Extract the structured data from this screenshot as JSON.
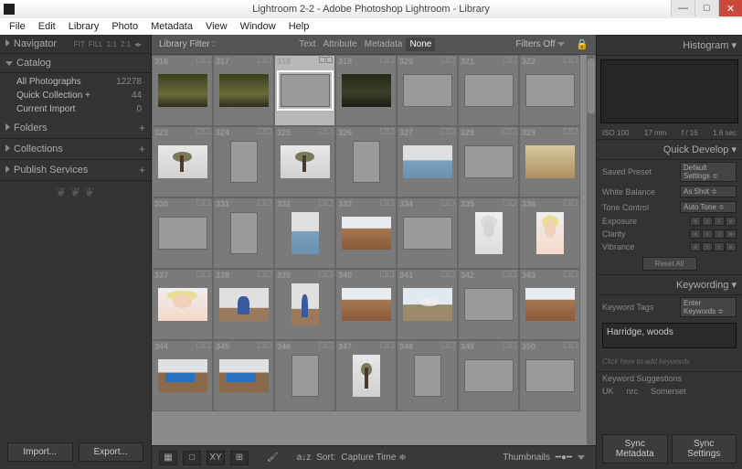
{
  "titlebar": {
    "title": "Lightroom 2-2 - Adobe Photoshop Lightroom - Library"
  },
  "menubar": [
    "File",
    "Edit",
    "Library",
    "Photo",
    "Metadata",
    "View",
    "Window",
    "Help"
  ],
  "left": {
    "navigator": {
      "label": "Navigator",
      "opts": [
        "FIT",
        "FILL",
        "1:1",
        "2:1"
      ]
    },
    "catalog": {
      "label": "Catalog",
      "items": [
        {
          "label": "All Photographs",
          "count": "12278"
        },
        {
          "label": "Quick Collection +",
          "count": "44"
        },
        {
          "label": "Current Import",
          "count": "0"
        }
      ]
    },
    "folders": {
      "label": "Folders"
    },
    "collections": {
      "label": "Collections"
    },
    "publish": {
      "label": "Publish Services"
    },
    "import_btn": "Import...",
    "export_btn": "Export..."
  },
  "filterbar": {
    "label": "Library Filter :",
    "tabs": [
      "Text",
      "Attribute",
      "Metadata",
      "None"
    ],
    "selected": "None",
    "filters_off": "Filters Off"
  },
  "grid": {
    "start_index": 316,
    "rows": [
      [
        {
          "n": "316",
          "kind": "river",
          "orient": "l"
        },
        {
          "n": "317",
          "kind": "river",
          "orient": "l"
        },
        {
          "n": "318",
          "kind": "blank",
          "orient": "l",
          "selected": true
        },
        {
          "n": "319",
          "kind": "river2",
          "orient": "l"
        },
        {
          "n": "320",
          "kind": "blank",
          "orient": "l"
        },
        {
          "n": "321",
          "kind": "blank",
          "orient": "l"
        },
        {
          "n": "322",
          "kind": "blank",
          "orient": "l"
        }
      ],
      [
        {
          "n": "323",
          "kind": "tree",
          "orient": "l"
        },
        {
          "n": "324",
          "kind": "blank",
          "orient": "p"
        },
        {
          "n": "325",
          "kind": "tree",
          "orient": "l"
        },
        {
          "n": "326",
          "kind": "blank",
          "orient": "p"
        },
        {
          "n": "327",
          "kind": "lake",
          "orient": "l"
        },
        {
          "n": "328",
          "kind": "blank",
          "orient": "l"
        },
        {
          "n": "329",
          "kind": "field",
          "orient": "l"
        }
      ],
      [
        {
          "n": "330",
          "kind": "blank",
          "orient": "l"
        },
        {
          "n": "331",
          "kind": "blank",
          "orient": "p"
        },
        {
          "n": "332",
          "kind": "lake",
          "orient": "p"
        },
        {
          "n": "333",
          "kind": "dirt",
          "orient": "l"
        },
        {
          "n": "334",
          "kind": "blank",
          "orient": "l"
        },
        {
          "n": "335",
          "kind": "portrait-bw",
          "orient": "p"
        },
        {
          "n": "336",
          "kind": "portrait",
          "orient": "p"
        }
      ],
      [
        {
          "n": "337",
          "kind": "portrait",
          "orient": "l"
        },
        {
          "n": "338",
          "kind": "walk",
          "orient": "l"
        },
        {
          "n": "339",
          "kind": "walk",
          "orient": "p"
        },
        {
          "n": "340",
          "kind": "dirt",
          "orient": "l"
        },
        {
          "n": "341",
          "kind": "smoke",
          "orient": "l"
        },
        {
          "n": "342",
          "kind": "blank",
          "orient": "l"
        },
        {
          "n": "343",
          "kind": "dirt",
          "orient": "l"
        }
      ],
      [
        {
          "n": "344",
          "kind": "truck",
          "orient": "l"
        },
        {
          "n": "345",
          "kind": "truck",
          "orient": "l"
        },
        {
          "n": "346",
          "kind": "blank",
          "orient": "p"
        },
        {
          "n": "347",
          "kind": "tree",
          "orient": "p"
        },
        {
          "n": "348",
          "kind": "blank",
          "orient": "p"
        },
        {
          "n": "349",
          "kind": "blank",
          "orient": "l"
        },
        {
          "n": "350",
          "kind": "blank",
          "orient": "l"
        }
      ]
    ]
  },
  "toolbar": {
    "sort_label": "Sort:",
    "sort_value": "Capture Time",
    "thumbnails_label": "Thumbnails"
  },
  "right": {
    "histogram": {
      "label": "Histogram",
      "iso": "ISO 100",
      "focal": "17 mm",
      "aperture": "f / 16",
      "shutter": "1.6 sec"
    },
    "quickdev": {
      "label": "Quick Develop",
      "rows": [
        {
          "k": "Saved Preset",
          "v": "Default Settings"
        },
        {
          "k": "White Balance",
          "v": "As Shot"
        },
        {
          "k": "Tone Control",
          "v": "Auto Tone"
        }
      ],
      "sliders": [
        "Exposure",
        "Clarity",
        "Vibrance"
      ],
      "reset": "Reset All"
    },
    "keywording": {
      "label": "Keywording",
      "tags_label": "Keyword Tags",
      "tags_mode": "Enter Keywords",
      "value": "Harridge, woods",
      "hint": "Click here to add keywords",
      "suggestions_label": "Keyword Suggestions",
      "suggestions": [
        "UK",
        "nrc",
        "Somerset"
      ]
    },
    "sync_meta": "Sync Metadata",
    "sync_settings": "Sync Settings"
  }
}
